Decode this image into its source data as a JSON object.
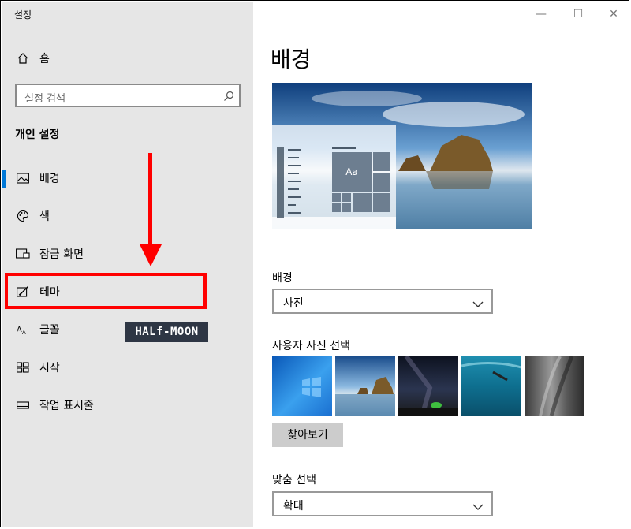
{
  "window": {
    "title": "설정",
    "minimize": "—",
    "maximize": "☐",
    "close": "✕"
  },
  "sidebar": {
    "home_label": "홈",
    "search_placeholder": "설정 검색",
    "section_title": "개인 설정",
    "items": [
      {
        "label": "배경",
        "icon": "picture-icon",
        "selected": true
      },
      {
        "label": "색",
        "icon": "palette-icon"
      },
      {
        "label": "잠금 화면",
        "icon": "lock-screen-icon"
      },
      {
        "label": "테마",
        "icon": "theme-icon"
      },
      {
        "label": "글꼴",
        "icon": "font-icon"
      },
      {
        "label": "시작",
        "icon": "start-icon"
      },
      {
        "label": "작업 표시줄",
        "icon": "taskbar-icon"
      }
    ]
  },
  "watermark": "HALf-MOON",
  "main": {
    "page_title": "배경",
    "preview": {
      "sample_text": "Aa"
    },
    "background_label": "배경",
    "background_value": "사진",
    "choose_photo_label": "사용자 사진 선택",
    "browse_button": "찾아보기",
    "fit_label": "맞춤 선택",
    "fit_value": "확대"
  },
  "colors": {
    "annotation_red": "#ff0000",
    "sidebar_bg": "#e6e6e6",
    "accent": "#0078d7"
  }
}
